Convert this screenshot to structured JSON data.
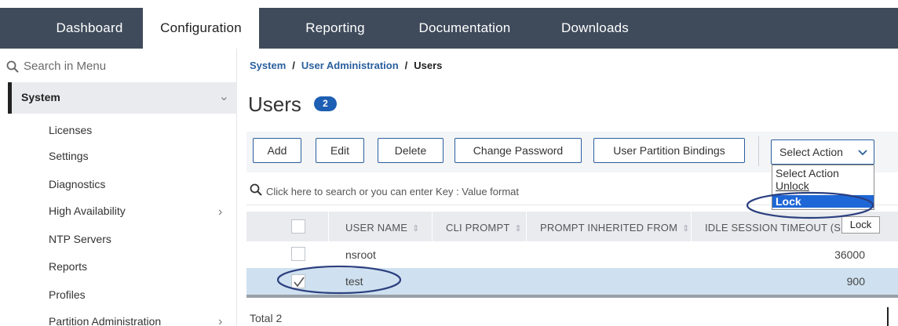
{
  "nav": {
    "tabs": [
      {
        "label": "Dashboard"
      },
      {
        "label": "Configuration"
      },
      {
        "label": "Reporting"
      },
      {
        "label": "Documentation"
      },
      {
        "label": "Downloads"
      }
    ]
  },
  "sidebar": {
    "search_placeholder": "Search in Menu",
    "section": "System",
    "items": [
      {
        "label": "Licenses"
      },
      {
        "label": "Settings"
      },
      {
        "label": "Diagnostics"
      },
      {
        "label": "High Availability"
      },
      {
        "label": "NTP Servers"
      },
      {
        "label": "Reports"
      },
      {
        "label": "Profiles"
      },
      {
        "label": "Partition Administration"
      }
    ]
  },
  "breadcrumb": {
    "level1": "System",
    "level2": "User Administration",
    "current": "Users",
    "separator": "/"
  },
  "page": {
    "title": "Users",
    "count": "2"
  },
  "toolbar": {
    "add": "Add",
    "edit": "Edit",
    "delete": "Delete",
    "change_password": "Change Password",
    "user_partition_bindings": "User Partition Bindings",
    "select_action": "Select Action"
  },
  "select_dropdown": {
    "options": [
      "Select Action",
      "Unlock",
      "Lock"
    ],
    "highlighted": "Lock",
    "tooltip": "Lock"
  },
  "search": {
    "placeholder": "Click here to search or you can enter Key : Value format"
  },
  "table": {
    "columns": [
      "USER NAME",
      "CLI PROMPT",
      "PROMPT INHERITED FROM",
      "IDLE SESSION TIMEOUT (S"
    ],
    "rows": [
      {
        "user": "nsroot",
        "timeout": "36000",
        "checked": false
      },
      {
        "user": "test",
        "timeout": "900",
        "checked": true
      }
    ],
    "footer_label": "Total",
    "footer_count": "2"
  },
  "colors": {
    "nav_bg": "#3f4b5b",
    "accent": "#1d5fb3",
    "link": "#2a5f9e",
    "selected_row": "#cfe1f0",
    "annotation": "#2b3f7f"
  }
}
